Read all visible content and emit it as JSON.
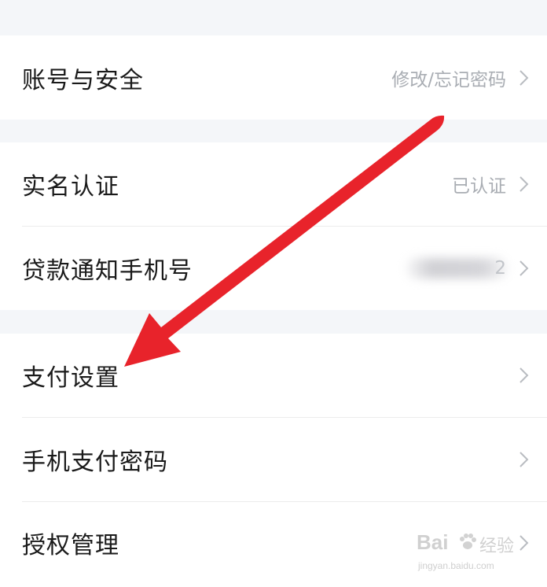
{
  "settings": {
    "account_security": {
      "label": "账号与安全",
      "value": "修改/忘记密码"
    },
    "real_name": {
      "label": "实名认证",
      "value": "已认证"
    },
    "loan_phone": {
      "label": "贷款通知手机号",
      "value_visible_tail": "2"
    },
    "payment_settings": {
      "label": "支付设置"
    },
    "mobile_pay_password": {
      "label": "手机支付密码"
    },
    "authorization": {
      "label": "授权管理"
    }
  },
  "watermark": {
    "brand": "Bai",
    "brand_cn": "经验",
    "url": "jingyan.baidu.com"
  },
  "colors": {
    "arrow": "#e8232b",
    "background": "#f4f6f9",
    "secondary_text": "#a9adb3"
  },
  "icons": [
    "chevron-right-icon",
    "paw-icon"
  ]
}
